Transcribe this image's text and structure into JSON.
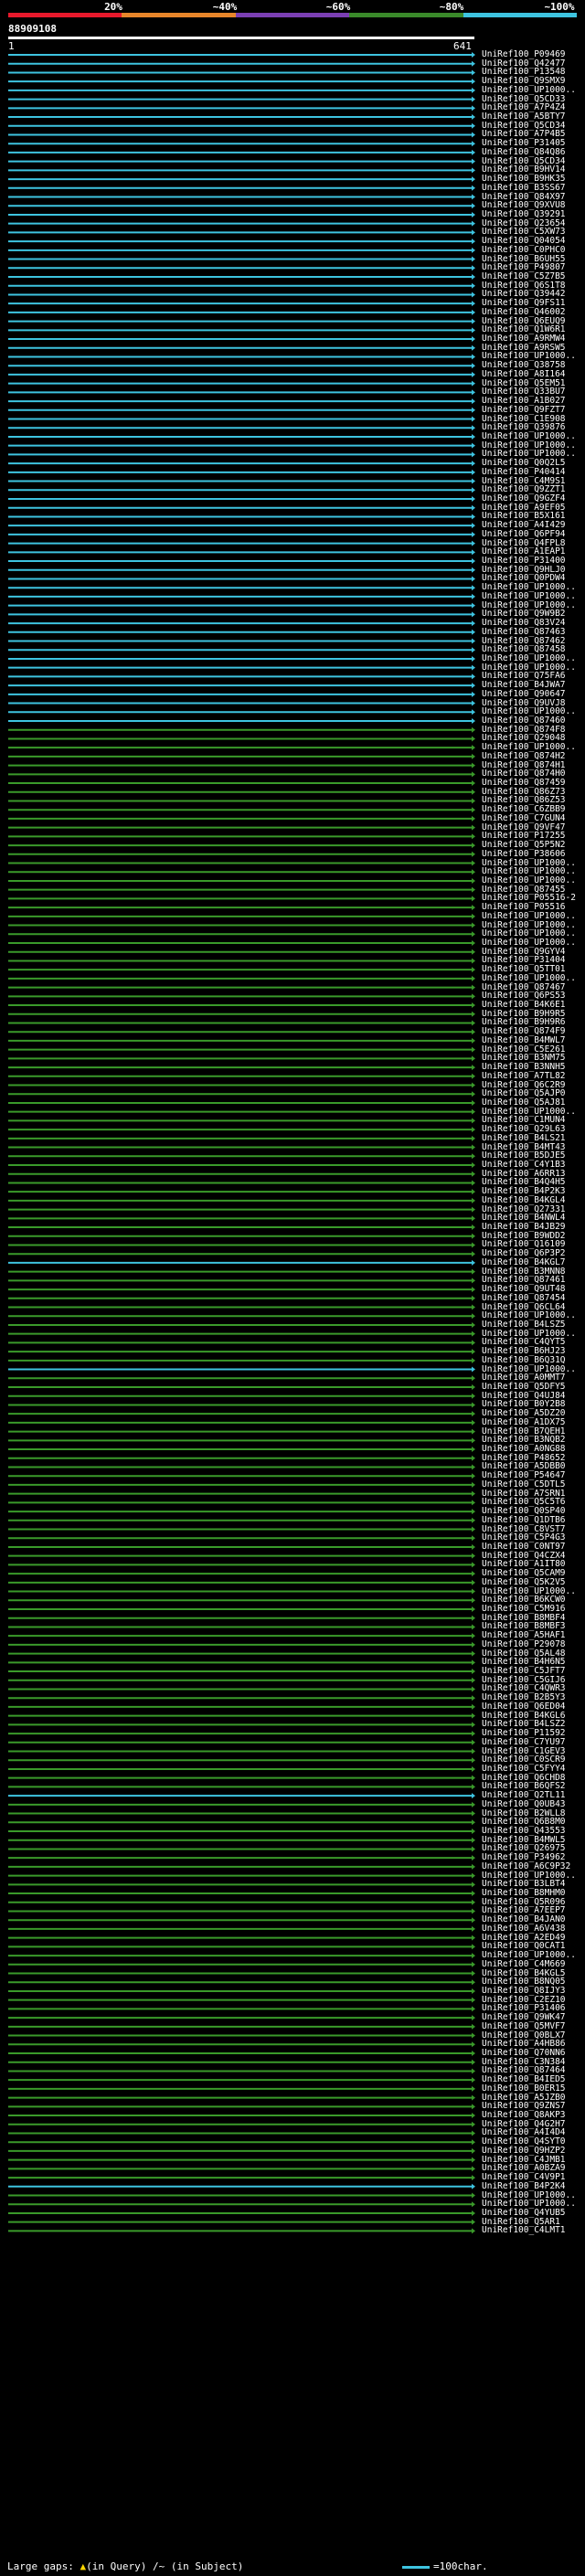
{
  "legend": {
    "labels": [
      "20%",
      "~40%",
      "~60%",
      "~80%",
      "~100%"
    ],
    "colors": [
      "#e8192c",
      "#e8862a",
      "#7b3fb3",
      "#3a8a2a",
      "#3ec4e0"
    ]
  },
  "query_id": "88909108",
  "ruler": {
    "start": "1",
    "end": "641"
  },
  "hit_colors": {
    "high": "#3ec4e0",
    "medium": "#3a9a2a"
  },
  "hits": [
    "UniRef100_P09469",
    "UniRef100_Q42477",
    "UniRef100_P13548",
    "UniRef100_Q9SMX9",
    "UniRef100_UP1000..",
    "UniRef100_Q5CD33",
    "UniRef100_A7P4Z4",
    "UniRef100_A5BTY7",
    "UniRef100_Q5CD34",
    "UniRef100_A7P4B5",
    "UniRef100_P31405",
    "UniRef100_Q84Q86",
    "UniRef100_Q5CD34",
    "UniRef100_B9HV14",
    "UniRef100_B9HK35",
    "UniRef100_B3SS67",
    "UniRef100_Q84X97",
    "UniRef100_Q9XVU8",
    "UniRef100_Q39291",
    "UniRef100_Q23654",
    "UniRef100_C5XW73",
    "UniRef100_Q04054",
    "UniRef100_C0PHC0",
    "UniRef100_B6UH55",
    "UniRef100_P49807",
    "UniRef100_C5Z7B5",
    "UniRef100_Q6S1T8",
    "UniRef100_Q39442",
    "UniRef100_Q9FS11",
    "UniRef100_Q46002",
    "UniRef100_Q6EUQ9",
    "UniRef100_Q1W6R1",
    "UniRef100_A9RMW4",
    "UniRef100_A9RSW5",
    "UniRef100_UP1000..",
    "UniRef100_Q38758",
    "UniRef100_A8I164",
    "UniRef100_Q5EM51",
    "UniRef100_Q33BU7",
    "UniRef100_A1B027",
    "UniRef100_Q9FZT7",
    "UniRef100_C1E908",
    "UniRef100_Q39876",
    "UniRef100_UP1000..",
    "UniRef100_UP1000..",
    "UniRef100_UP1000..",
    "UniRef100_Q0Q2L5",
    "UniRef100_P40414",
    "UniRef100_C4M9S1",
    "UniRef100_Q9ZZT1",
    "UniRef100_Q9GZF4",
    "UniRef100_A9EF05",
    "UniRef100_B5X161",
    "UniRef100_A4I429",
    "UniRef100_Q6PF94",
    "UniRef100_Q4FPL8",
    "UniRef100_A1EAP1",
    "UniRef100_P31400",
    "UniRef100_Q9HLJ0",
    "UniRef100_Q0PDW4",
    "UniRef100_UP1000..",
    "UniRef100_UP1000..",
    "UniRef100_UP1000..",
    "UniRef100_Q9W9B2",
    "UniRef100_Q83V24",
    "UniRef100_Q87463",
    "UniRef100_Q87462",
    "UniRef100_Q87458",
    "UniRef100_UP1000..",
    "UniRef100_UP1000..",
    "UniRef100_Q75FA6",
    "UniRef100_B4JWA7",
    "UniRef100_Q90647",
    "UniRef100_Q9UVJ8",
    "UniRef100_UP1000..",
    "UniRef100_Q87460",
    "UniRef100_Q874F8",
    "UniRef100_Q29048",
    "UniRef100_UP1000..",
    "UniRef100_Q874H2",
    "UniRef100_Q874H1",
    "UniRef100_Q874H0",
    "UniRef100_Q87459",
    "UniRef100_Q86Z73",
    "UniRef100_Q86Z53",
    "UniRef100_C6ZBB9",
    "UniRef100_C7GUN4",
    "UniRef100_Q9VF47",
    "UniRef100_P17255",
    "UniRef100_Q5P5N2",
    "UniRef100_P38606",
    "UniRef100_UP1000..",
    "UniRef100_UP1000..",
    "UniRef100_UP1000..",
    "UniRef100_Q87455",
    "UniRef100_P05516-2",
    "UniRef100_P05516",
    "UniRef100_UP1000..",
    "UniRef100_UP1000..",
    "UniRef100_UP1000..",
    "UniRef100_UP1000..",
    "UniRef100_Q9GYV4",
    "UniRef100_P31404",
    "UniRef100_Q5TT01",
    "UniRef100_UP1000..",
    "UniRef100_Q87467",
    "UniRef100_Q6PS53",
    "UniRef100_B4K6E1",
    "UniRef100_B9H9R5",
    "UniRef100_B9H9R6",
    "UniRef100_Q874F9",
    "UniRef100_B4MWL7",
    "UniRef100_C5E261",
    "UniRef100_B3NM75",
    "UniRef100_B3NNH5",
    "UniRef100_A7TL82",
    "UniRef100_Q6C2R9",
    "UniRef100_Q5AJP0",
    "UniRef100_Q5AJ81",
    "UniRef100_UP1000..",
    "UniRef100_C1MUN4",
    "UniRef100_Q29L63",
    "UniRef100_B4LS21",
    "UniRef100_B4MT43",
    "UniRef100_B5DJE5",
    "UniRef100_C4Y1B3",
    "UniRef100_A6RR13",
    "UniRef100_B4Q4H5",
    "UniRef100_B4P2K3",
    "UniRef100_B4KGL4",
    "UniRef100_Q27331",
    "UniRef100_B4NWL4",
    "UniRef100_B4JB29",
    "UniRef100_B9WDD2",
    "UniRef100_Q16109",
    "UniRef100_Q6P3P2",
    "UniRef100_B4KGL7",
    "UniRef100_B3MNN8",
    "UniRef100_Q87461",
    "UniRef100_Q9UT48",
    "UniRef100_Q87454",
    "UniRef100_Q6CL64",
    "UniRef100_UP1000..",
    "UniRef100_B4LSZ5",
    "UniRef100_UP1000..",
    "UniRef100_C4QYT5",
    "UniRef100_B6HJ23",
    "UniRef100_B6Q31Q",
    "UniRef100_UP1000..",
    "UniRef100_A0MMT7",
    "UniRef100_Q5DFY5",
    "UniRef100_Q4UJ84",
    "UniRef100_B0Y2B8",
    "UniRef100_A5DZ20",
    "UniRef100_A1DX75",
    "UniRef100_B7QEH1",
    "UniRef100_B3NQB2",
    "UniRef100_A0NG88",
    "UniRef100_P48652",
    "UniRef100_A5DBB0",
    "UniRef100_P54647",
    "UniRef100_C5DTL5",
    "UniRef100_A7SRN1",
    "UniRef100_Q5C5T6",
    "UniRef100_Q0SP40",
    "UniRef100_Q1DTB6",
    "UniRef100_C8VST7",
    "UniRef100_C5P4G3",
    "UniRef100_C0NT97",
    "UniRef100_Q4CZX4",
    "UniRef100_A1IT80",
    "UniRef100_Q5CAM9",
    "UniRef100_Q5K2V5",
    "UniRef100_UP1000..",
    "UniRef100_B6KCW0",
    "UniRef100_C5M916",
    "UniRef100_B8MBF4",
    "UniRef100_B8MBF3",
    "UniRef100_A5HAF1",
    "UniRef100_P29078",
    "UniRef100_Q5AL48",
    "UniRef100_B4H6N5",
    "UniRef100_C5JFT7",
    "UniRef100_C5GIJ6",
    "UniRef100_C4QWR3",
    "UniRef100_B2B5Y3",
    "UniRef100_Q6ED04",
    "UniRef100_B4KGL6",
    "UniRef100_B4LSZ2",
    "UniRef100_P11592",
    "UniRef100_C7YU97",
    "UniRef100_C1GEV3",
    "UniRef100_C0SCR9",
    "UniRef100_C5FYY4",
    "UniRef100_Q6CHD8",
    "UniRef100_B6QFS2",
    "UniRef100_Q2TL11",
    "UniRef100_Q0UB43",
    "UniRef100_B2WLL8",
    "UniRef100_Q6B8M0",
    "UniRef100_Q43553",
    "UniRef100_B4MWL5",
    "UniRef100_Q26975",
    "UniRef100_P34962",
    "UniRef100_A6C9P32",
    "UniRef100_UP1000..",
    "UniRef100_B3LBT4",
    "UniRef100_B8MHM0",
    "UniRef100_Q5R096",
    "UniRef100_A7EEP7",
    "UniRef100_B4JAN0",
    "UniRef100_A6V438",
    "UniRef100_A2ED49",
    "UniRef100_Q0CAT1",
    "UniRef100_UP1000..",
    "UniRef100_C4M669",
    "UniRef100_B4KGL5",
    "UniRef100_B8NQ05",
    "UniRef100_Q8IJY3",
    "UniRef100_C2EZ10",
    "UniRef100_P31406",
    "UniRef100_Q9WK47",
    "UniRef100_Q5MVF7",
    "UniRef100_Q0BLX7",
    "UniRef100_A4HB86",
    "UniRef100_Q70NN6",
    "UniRef100_C3N384",
    "UniRef100_Q87464",
    "UniRef100_B4IED5",
    "UniRef100_B0ER15",
    "UniRef100_A5JZB0",
    "UniRef100_Q9ZNS7",
    "UniRef100_Q8AKP3",
    "UniRef100_Q4G2H7",
    "UniRef100_A4I4D4",
    "UniRef100_Q4SYT0",
    "UniRef100_Q9HZP2",
    "UniRef100_C4JMB1",
    "UniRef100_A0BZA9",
    "UniRef100_C4V9P1",
    "UniRef100_B4P2K4",
    "UniRef100_UP1000..",
    "UniRef100_UP1000..",
    "UniRef100_Q4YUB5",
    "UniRef100_Q5AR1",
    "UniRef100_C4LMT1"
  ],
  "footer": {
    "gaps_label": "Large gaps:",
    "gaps_in_query": "(in Query)",
    "gaps_in_subject": "(in Subject)",
    "scale_label": "=100char."
  }
}
